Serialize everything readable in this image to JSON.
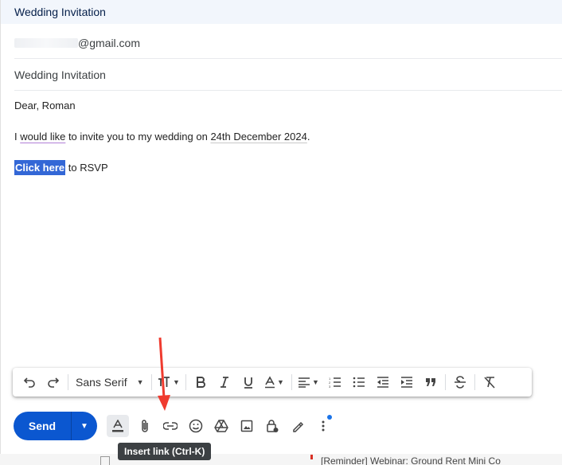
{
  "window": {
    "title": "Wedding Invitation"
  },
  "to": {
    "value": "@gmail.com"
  },
  "subject": {
    "value": "Wedding Invitation"
  },
  "body": {
    "greeting": "Dear, Roman",
    "line1_a": "I ",
    "line1_b": "would like",
    "line1_c": " to invite you to my wedding on ",
    "line1_d": "24th December 2024",
    "line1_e": ".",
    "link_text": "Click here",
    "line2_rest": " to RSVP"
  },
  "format_toolbar": {
    "font": "Sans Serif",
    "items": [
      "undo-icon",
      "redo-icon",
      "text-size-icon",
      "bold-icon",
      "italic-icon",
      "underline-icon",
      "text-color-icon",
      "align-icon",
      "numbered-list-icon",
      "bulleted-list-icon",
      "indent-less-icon",
      "indent-more-icon",
      "quote-icon",
      "strikethrough-icon",
      "remove-formatting-icon"
    ]
  },
  "actions": {
    "send_label": "Send",
    "tooltip": "Insert link (Ctrl-K)"
  },
  "behind": {
    "snippet": "[Reminder] Webinar: Ground Rent Mini Co"
  },
  "colors": {
    "send": "#0b57d0",
    "selection": "#3367d6",
    "arrow": "#ef3b2f"
  }
}
